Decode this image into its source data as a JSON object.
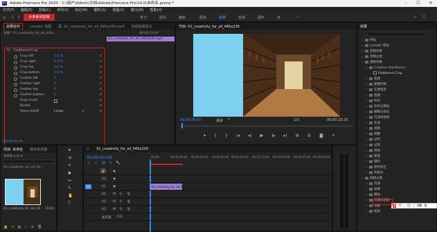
{
  "window": {
    "title": "Adobe Premiere Pro 2020 - C:\\用户\\Admin\\文档\\Adobe\\Premiere Pro\\14.0\\未命名.prproj *",
    "logo": "Pr"
  },
  "menu": [
    "文件(F)",
    "编辑(E)",
    "剪辑(C)",
    "序列(S)",
    "标记(M)",
    "图形(G)",
    "视图(V)",
    "窗口(W)",
    "帮助(H)"
  ],
  "workspaces": {
    "flash": "头条系列剪辑",
    "items": [
      "学习",
      "组件",
      "编辑",
      "颜色",
      "效果",
      "音频",
      "图形",
      "库"
    ],
    "active_index": 4
  },
  "effect_controls": {
    "tabs": [
      "效果控件",
      "Lumetri 范围",
      "源: 01_creativity_for_all_445x239.mp4",
      "音频剪辑混合"
    ],
    "source": "主要 * 01_creativity_for_all_445x...",
    "clip_name": "01_creativity_for_all_445x239.mp4",
    "timecode": "00:00:15:00",
    "effect_name": "Feathered Crop",
    "params": [
      {
        "name": "Crop left",
        "value": "0.0 %"
      },
      {
        "name": "Crop right",
        "value": "0.0 %"
      },
      {
        "name": "Crop top",
        "value": "0.0 %"
      },
      {
        "name": "Crop bottom",
        "value": "0.0 %"
      },
      {
        "name": "Feather left",
        "value": "0"
      },
      {
        "name": "Feather right",
        "value": "0"
      },
      {
        "name": "Feather top",
        "value": "0"
      },
      {
        "name": "Feather bottom",
        "value": "0"
      }
    ],
    "crop_invert": "Crop invert",
    "border": "Border",
    "alpha_falloff": "Alpha falloff",
    "alpha_value": "Linear",
    "footer_time": "00:00:00:00"
  },
  "program": {
    "tab": "节目: 01_creativity_for_all_445x239",
    "timecode": "00:00:00:00",
    "fit": "适合",
    "ratio": "1/2",
    "duration": "00:00:23:25"
  },
  "project": {
    "tabs": [
      "项目: 未命名",
      "媒体浏览器",
      "库",
      "信息"
    ],
    "file": "未命名.prproj",
    "item": "01_creativity_for_all_44...",
    "thumb_name": "01_creativity_for_all_44",
    "thumb_dur": "23:25"
  },
  "timeline": {
    "tab": "01_creativity_for_all_445x239",
    "timecode": "00:00:00:00",
    "ruler": [
      "00:00",
      "00:00:15:00",
      "00:00:30:00",
      "00:00:45:00",
      "00:01:00:00",
      "00:01:15:00",
      "00:01:30:00",
      "00:01:45:00",
      "00:02:00:00",
      "00:02:15:00",
      "00:02:30:00"
    ],
    "video_tracks": [
      "V3",
      "V2",
      "V1"
    ],
    "audio_tracks": [
      "A1",
      "A2",
      "A3"
    ],
    "master": "主声道",
    "master_val": "0.0",
    "clip": "01_creativity_for_all_44"
  },
  "effects": {
    "tab": "效果",
    "items": [
      {
        "label": "预设",
        "level": 0,
        "type": "folder"
      },
      {
        "label": "Lumetri 预设",
        "level": 0,
        "type": "folder"
      },
      {
        "label": "音频效果",
        "level": 0,
        "type": "folder"
      },
      {
        "label": "音频过渡",
        "level": 0,
        "type": "folder"
      },
      {
        "label": "视频效果",
        "level": 0,
        "type": "folder"
      },
      {
        "label": "Creative Impatience",
        "level": 1,
        "type": "folder"
      },
      {
        "label": "Feathered Crop",
        "level": 2,
        "type": "fx"
      },
      {
        "label": "变换",
        "level": 1,
        "type": "folder"
      },
      {
        "label": "图像控制",
        "level": 1,
        "type": "folder"
      },
      {
        "label": "实用程序",
        "level": 1,
        "type": "folder"
      },
      {
        "label": "扭曲",
        "level": 1,
        "type": "folder"
      },
      {
        "label": "时间",
        "level": 1,
        "type": "folder"
      },
      {
        "label": "杂色与颗粒",
        "level": 1,
        "type": "folder"
      },
      {
        "label": "模糊与锐化",
        "level": 1,
        "type": "folder"
      },
      {
        "label": "沉浸式视频",
        "level": 1,
        "type": "folder"
      },
      {
        "label": "生成",
        "level": 1,
        "type": "folder"
      },
      {
        "label": "视频",
        "level": 1,
        "type": "folder"
      },
      {
        "label": "调整",
        "level": 1,
        "type": "folder"
      },
      {
        "label": "过时",
        "level": 1,
        "type": "folder"
      },
      {
        "label": "过渡",
        "level": 1,
        "type": "folder"
      },
      {
        "label": "透视",
        "level": 1,
        "type": "folder"
      },
      {
        "label": "通道",
        "level": 1,
        "type": "folder"
      },
      {
        "label": "键控",
        "level": 1,
        "type": "folder"
      },
      {
        "label": "颜色校正",
        "level": 1,
        "type": "folder"
      },
      {
        "label": "风格化",
        "level": 1,
        "type": "folder"
      },
      {
        "label": "视频过渡",
        "level": 0,
        "type": "folder"
      },
      {
        "label": "内滑",
        "level": 1,
        "type": "folder"
      },
      {
        "label": "划像",
        "level": 1,
        "type": "folder"
      },
      {
        "label": "擦除",
        "level": 1,
        "type": "folder"
      },
      {
        "label": "沉浸式视频",
        "level": 1,
        "type": "folder"
      },
      {
        "label": "溶解",
        "level": 1,
        "type": "folder"
      },
      {
        "label": "缩放",
        "level": 1,
        "type": "folder"
      }
    ],
    "ime": "中"
  },
  "colors": {
    "accent": "#3d8cf0",
    "highlight": "#e02020",
    "preview_cyan": "#7ed0f0",
    "clip": "#9b7fd0"
  }
}
